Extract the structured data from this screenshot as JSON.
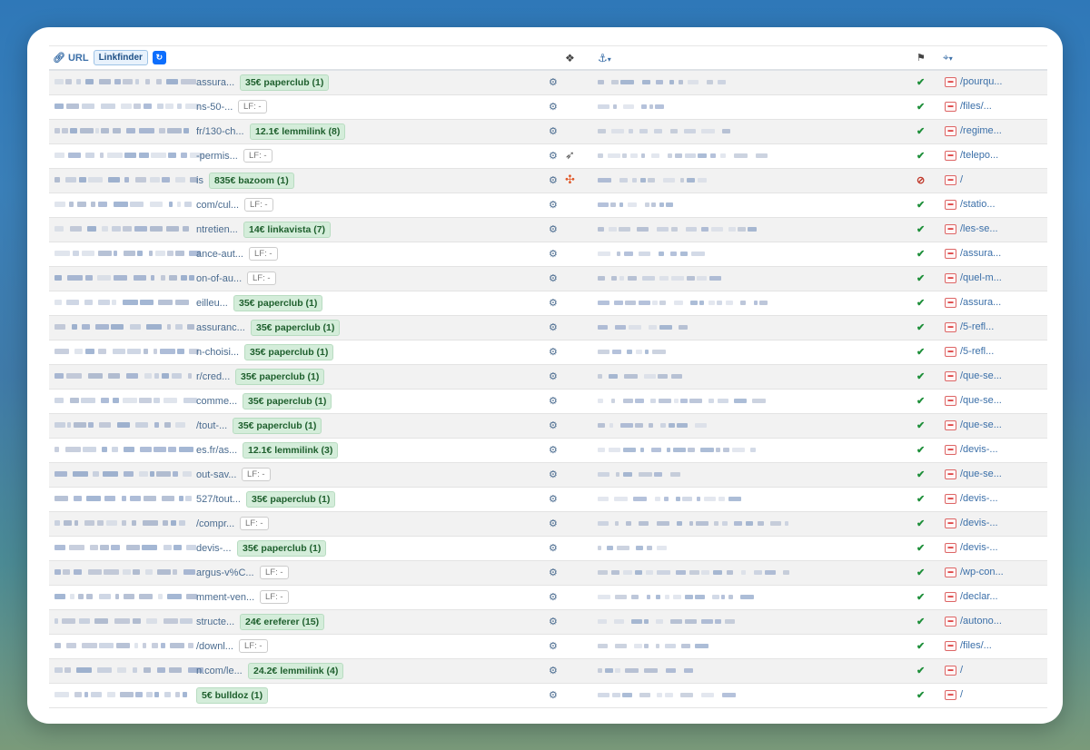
{
  "header": {
    "url_label": "URL",
    "linkfinder_label": "Linkfinder",
    "refresh_label": "↻",
    "cms_icon": "cubes-icon",
    "anchor_icon": "anchor-icon",
    "flag_icon": "flag-icon",
    "target_icon": "crosshair-icon"
  },
  "rows": [
    {
      "url": "assura...",
      "badge": "35€ paperclub (1)",
      "badge_type": "s",
      "cms": "",
      "status": "ok",
      "target": "/pourqu..."
    },
    {
      "url": "ns-50-...",
      "badge": "LF: -",
      "badge_type": "lf",
      "cms": "",
      "status": "ok",
      "target": "/files/..."
    },
    {
      "url": "fr/130-ch...",
      "badge": "12.1€ lemmilink (8)",
      "badge_type": "s",
      "cms": "",
      "status": "ok",
      "target": "/regime..."
    },
    {
      "url": "-permis...",
      "badge": "LF: -",
      "badge_type": "lf",
      "cms": "bird",
      "status": "ok",
      "target": "/telepo..."
    },
    {
      "url": "is",
      "badge": "835€ bazoom (1)",
      "badge_type": "s",
      "cms": "joomla",
      "status": "ban",
      "target": "/"
    },
    {
      "url": "com/cul...",
      "badge": "LF: -",
      "badge_type": "lf",
      "cms": "",
      "status": "ok",
      "target": "/statio..."
    },
    {
      "url": "ntretien...",
      "badge": "14€ linkavista (7)",
      "badge_type": "s",
      "cms": "",
      "status": "ok",
      "target": "/les-se..."
    },
    {
      "url": "ance-aut...",
      "badge": "LF: -",
      "badge_type": "lf",
      "cms": "",
      "status": "ok",
      "target": "/assura..."
    },
    {
      "url": "on-of-au...",
      "badge": "LF: -",
      "badge_type": "lf",
      "cms": "",
      "status": "ok",
      "target": "/quel-m..."
    },
    {
      "url": "eilleu...",
      "badge": "35€ paperclub (1)",
      "badge_type": "s",
      "cms": "",
      "status": "ok",
      "target": "/assura..."
    },
    {
      "url": "assuranc...",
      "badge": "35€ paperclub (1)",
      "badge_type": "s",
      "cms": "",
      "status": "ok",
      "target": "/5-refl..."
    },
    {
      "url": "n-choisi...",
      "badge": "35€ paperclub (1)",
      "badge_type": "s",
      "cms": "",
      "status": "ok",
      "target": "/5-refl..."
    },
    {
      "url": "r/cred...",
      "badge": "35€ paperclub (1)",
      "badge_type": "s",
      "cms": "",
      "status": "ok",
      "target": "/que-se..."
    },
    {
      "url": "comme...",
      "badge": "35€ paperclub (1)",
      "badge_type": "s",
      "cms": "",
      "status": "ok",
      "target": "/que-se..."
    },
    {
      "url": "/tout-...",
      "badge": "35€ paperclub (1)",
      "badge_type": "s",
      "cms": "",
      "status": "ok",
      "target": "/que-se..."
    },
    {
      "url": "es.fr/as...",
      "badge": "12.1€ lemmilink (3)",
      "badge_type": "s",
      "cms": "",
      "status": "ok",
      "target": "/devis-..."
    },
    {
      "url": "out-sav...",
      "badge": "LF: -",
      "badge_type": "lf",
      "cms": "",
      "status": "ok",
      "target": "/que-se..."
    },
    {
      "url": "527/tout...",
      "badge": "35€ paperclub (1)",
      "badge_type": "s",
      "cms": "",
      "status": "ok",
      "target": "/devis-..."
    },
    {
      "url": "/compr...",
      "badge": "LF: -",
      "badge_type": "lf",
      "cms": "",
      "status": "ok",
      "target": "/devis-..."
    },
    {
      "url": "devis-...",
      "badge": "35€ paperclub (1)",
      "badge_type": "s",
      "cms": "",
      "status": "ok",
      "target": "/devis-..."
    },
    {
      "url": "argus-v%C...",
      "badge": "LF: -",
      "badge_type": "lf",
      "cms": "",
      "status": "ok",
      "target": "/wp-con..."
    },
    {
      "url": "mment-ven...",
      "badge": "LF: -",
      "badge_type": "lf",
      "cms": "",
      "status": "ok",
      "target": "/declar..."
    },
    {
      "url": "structe...",
      "badge": "24€ ereferer (15)",
      "badge_type": "s",
      "cms": "",
      "status": "ok",
      "target": "/autono..."
    },
    {
      "url": "/downl...",
      "badge": "LF: -",
      "badge_type": "lf",
      "cms": "",
      "status": "ok",
      "target": "/files/..."
    },
    {
      "url": "n.com/le...",
      "badge": "24.2€ lemmilink (4)",
      "badge_type": "s",
      "cms": "",
      "status": "ok",
      "target": "/"
    },
    {
      "url": "",
      "badge": "5€ bulldoz (1)",
      "badge_type": "s",
      "cms": "",
      "status": "ok",
      "target": "/"
    }
  ],
  "colors": {
    "success_bg": "#d4edda",
    "link": "#3b6fa8",
    "check": "#1e8f3a",
    "ban": "#c0392b"
  }
}
